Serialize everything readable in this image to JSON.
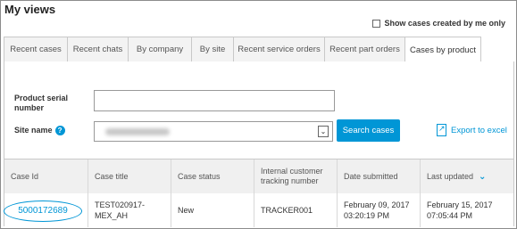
{
  "header": {
    "title": "My views",
    "show_cases_label": "Show cases created by me only"
  },
  "tabs": [
    {
      "label": "Recent cases"
    },
    {
      "label": "Recent chats"
    },
    {
      "label": "By company"
    },
    {
      "label": "By site"
    },
    {
      "label": "Recent service orders"
    },
    {
      "label": "Recent part orders"
    },
    {
      "label": "Cases by product",
      "active": true
    }
  ],
  "form": {
    "serial_label_line1": "Product serial",
    "serial_label_line2": "number",
    "serial_value": "",
    "site_label": "Site name",
    "search_button": "Search cases",
    "export_label": "Export to excel"
  },
  "table": {
    "columns": [
      {
        "line1": "Case Id",
        "line2": ""
      },
      {
        "line1": "Case title",
        "line2": ""
      },
      {
        "line1": "Case status",
        "line2": ""
      },
      {
        "line1": "Internal customer",
        "line2": "tracking number"
      },
      {
        "line1": "Date submitted",
        "line2": ""
      },
      {
        "line1": "Last updated",
        "line2": ""
      }
    ],
    "rows": [
      {
        "case_id": "5000172689",
        "title_line1": "TEST020917-",
        "title_line2": "MEX_AH",
        "status": "New",
        "tracking": "TRACKER001",
        "submitted_line1": "February 09, 2017",
        "submitted_line2": "03:20:19 PM",
        "updated_line1": "February 15, 2017",
        "updated_line2": "07:05:44 PM"
      }
    ]
  },
  "colors": {
    "accent": "#0096d6",
    "border": "#c9c9c9",
    "header_bg": "#f0f0f0"
  },
  "icons": {
    "help": "help-icon",
    "export": "export-icon",
    "sort": "chevron-down-icon",
    "dropdown": "dropdown-arrow-icon"
  }
}
